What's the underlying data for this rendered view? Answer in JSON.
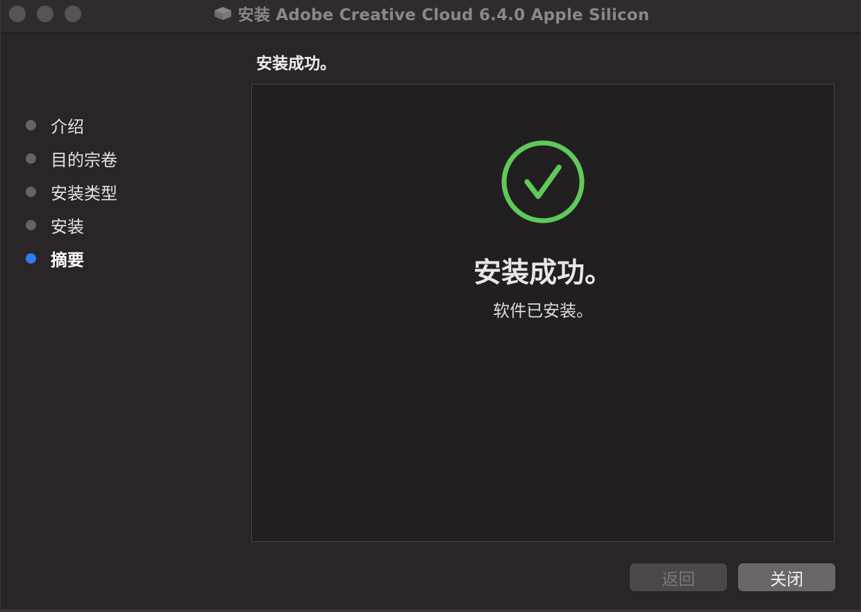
{
  "window": {
    "title": "安装 Adobe Creative Cloud 6.4.0 Apple Silicon",
    "title_icon": "package-icon"
  },
  "sidebar": {
    "steps": [
      {
        "label": "介绍",
        "state": "done"
      },
      {
        "label": "目的宗卷",
        "state": "done"
      },
      {
        "label": "安装类型",
        "state": "done"
      },
      {
        "label": "安装",
        "state": "done"
      },
      {
        "label": "摘要",
        "state": "current"
      }
    ]
  },
  "main": {
    "heading": "安装成功。",
    "status_icon": "checkmark-circle-icon",
    "status_color": "#5fc95a",
    "success_title": "安装成功。",
    "success_subtitle": "软件已安装。"
  },
  "buttons": {
    "back_label": "返回",
    "close_label": "关闭"
  },
  "colors": {
    "current_step_dot": "#2f7cf6",
    "inactive_step_dot": "#676364"
  }
}
